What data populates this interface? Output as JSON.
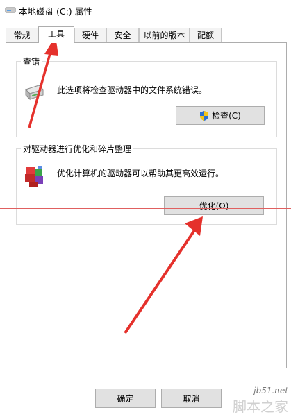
{
  "window": {
    "title": "本地磁盘 (C:) 属性"
  },
  "tabs": [
    {
      "label": "常规"
    },
    {
      "label": "工具",
      "active": true
    },
    {
      "label": "硬件"
    },
    {
      "label": "安全"
    },
    {
      "label": "以前的版本"
    },
    {
      "label": "配额"
    }
  ],
  "error_check": {
    "title": "查错",
    "description": "此选项将检查驱动器中的文件系统错误。",
    "button": "检查(C)",
    "icons": [
      "drive-icon",
      "shield-icon"
    ]
  },
  "optimize": {
    "title": "对驱动器进行优化和碎片整理",
    "description": "优化计算机的驱动器可以帮助其更高效运行。",
    "button": "优化(O)",
    "icons": [
      "defrag-icon"
    ]
  },
  "footer": {
    "ok": "确定",
    "cancel": "取消"
  },
  "annotations": {
    "color": "#e5312c"
  },
  "watermark": {
    "url": "jb51.net",
    "name": "脚本之家"
  }
}
